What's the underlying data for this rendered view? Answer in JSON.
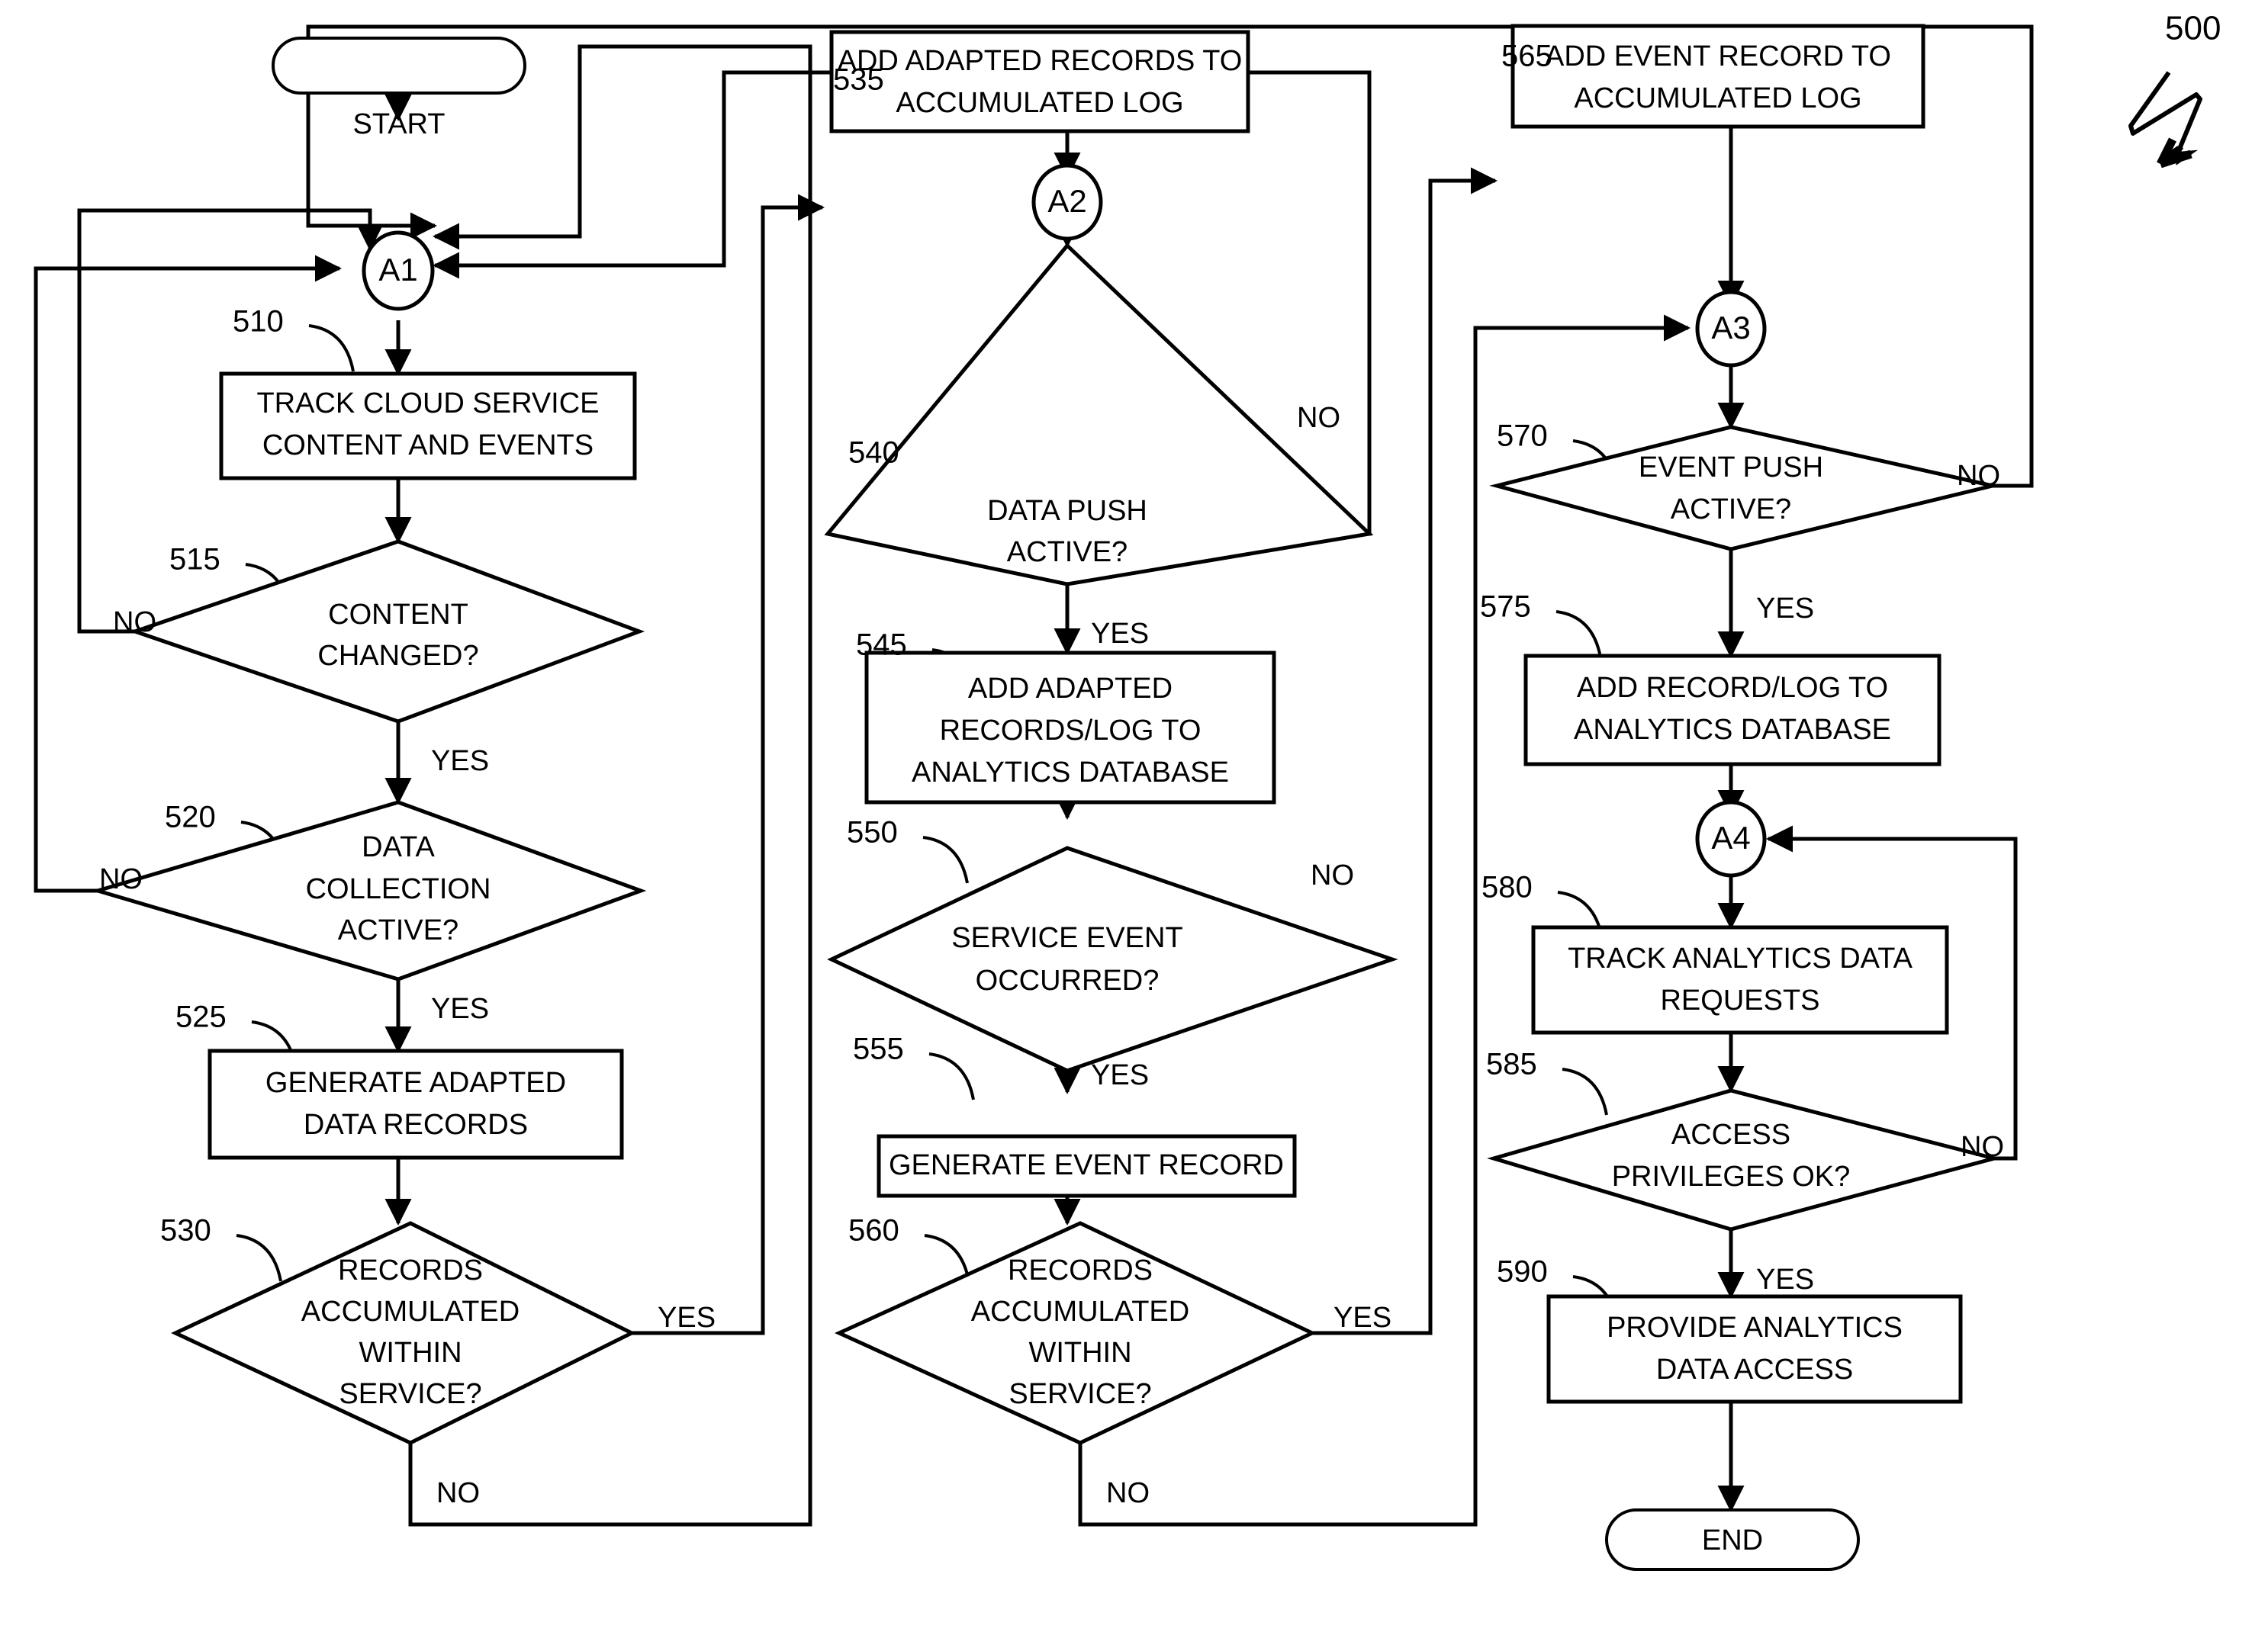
{
  "figure": {
    "number": "500"
  },
  "terminators": {
    "start": "START",
    "end": "END"
  },
  "junctions": [
    {
      "id": "A1",
      "label": "A1"
    },
    {
      "id": "A2",
      "label": "A2"
    },
    {
      "id": "A3",
      "label": "A3"
    },
    {
      "id": "A4",
      "label": "A4"
    }
  ],
  "steps": [
    {
      "ref": "510",
      "type": "process",
      "label_line1": "TRACK CLOUD SERVICE",
      "label_line2": "CONTENT AND EVENTS"
    },
    {
      "ref": "515",
      "type": "decision",
      "label_line1": "CONTENT",
      "label_line2": "CHANGED?"
    },
    {
      "ref": "520",
      "type": "decision",
      "label_line1": "DATA",
      "label_line2": "COLLECTION",
      "label_line3": "ACTIVE?"
    },
    {
      "ref": "525",
      "type": "process",
      "label_line1": "GENERATE ADAPTED",
      "label_line2": "DATA RECORDS"
    },
    {
      "ref": "530",
      "type": "decision",
      "label_line1": "RECORDS",
      "label_line2": "ACCUMULATED",
      "label_line3": "WITHIN",
      "label_line4": "SERVICE?"
    },
    {
      "ref": "535",
      "type": "process",
      "label_line1": "ADD ADAPTED RECORDS TO",
      "label_line2": "ACCUMULATED LOG"
    },
    {
      "ref": "540",
      "type": "decision",
      "label_line1": "DATA PUSH",
      "label_line2": "ACTIVE?"
    },
    {
      "ref": "545",
      "type": "process",
      "label_line1": "ADD ADAPTED",
      "label_line2": "RECORDS/LOG TO",
      "label_line3": "ANALYTICS DATABASE"
    },
    {
      "ref": "550",
      "type": "decision",
      "label_line1": "SERVICE EVENT",
      "label_line2": "OCCURRED?"
    },
    {
      "ref": "555",
      "type": "process",
      "label_line1": "GENERATE EVENT RECORD"
    },
    {
      "ref": "560",
      "type": "decision",
      "label_line1": "RECORDS",
      "label_line2": "ACCUMULATED",
      "label_line3": "WITHIN",
      "label_line4": "SERVICE?"
    },
    {
      "ref": "565",
      "type": "process",
      "label_line1": "ADD EVENT RECORD TO",
      "label_line2": "ACCUMULATED LOG"
    },
    {
      "ref": "570",
      "type": "decision",
      "label_line1": "EVENT PUSH",
      "label_line2": "ACTIVE?"
    },
    {
      "ref": "575",
      "type": "process",
      "label_line1": "ADD RECORD/LOG TO",
      "label_line2": "ANALYTICS DATABASE"
    },
    {
      "ref": "580",
      "type": "process",
      "label_line1": "TRACK ANALYTICS DATA",
      "label_line2": "REQUESTS"
    },
    {
      "ref": "585",
      "type": "decision",
      "label_line1": "ACCESS",
      "label_line2": "PRIVILEGES OK?"
    },
    {
      "ref": "590",
      "type": "process",
      "label_line1": "PROVIDE ANALYTICS",
      "label_line2": "DATA ACCESS"
    }
  ],
  "branch_labels": {
    "no_515": "NO",
    "yes_515": "YES",
    "no_520": "NO",
    "yes_520": "YES",
    "yes_530": "YES",
    "no_530": "NO",
    "no_540": "NO",
    "yes_540": "YES",
    "no_550": "NO",
    "yes_550": "YES",
    "yes_560": "YES",
    "no_560": "NO",
    "no_570": "NO",
    "yes_570": "YES",
    "no_585": "NO",
    "yes_585": "YES"
  },
  "colors": {
    "stroke": "#000000",
    "fill": "#ffffff"
  }
}
